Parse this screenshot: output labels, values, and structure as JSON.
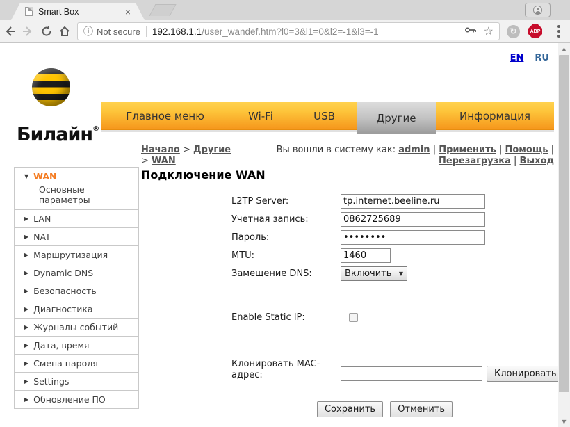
{
  "browser": {
    "tab_title": "Smart Box",
    "security_label": "Not secure",
    "url_domain": "192.168.1.1",
    "url_path": "/user_wandef.htm?l0=3&l1=0&l2=-1&l3=-1",
    "abp_badge": "ABP"
  },
  "icons": {
    "close": "×",
    "star": "☆",
    "info": "ⓘ",
    "sync": "↻",
    "wan_arrow": "▼",
    "item_arrow": "▶",
    "select_arrow": "▼",
    "scroll_up": "▲",
    "scroll_down": "▼"
  },
  "page": {
    "lang": {
      "en": "EN",
      "ru": "RU"
    },
    "logo": {
      "text": "Билайн",
      "reg": "®"
    },
    "nav": [
      {
        "label": "Главное меню"
      },
      {
        "label": "Wi-Fi"
      },
      {
        "label": "USB"
      },
      {
        "label": "Другие"
      },
      {
        "label": "Информация"
      }
    ],
    "breadcrumb": {
      "home": "Начало",
      "sep": ">",
      "section": "Другие",
      "page": "WAN"
    },
    "session": {
      "prefix": "Вы вошли в систему как:",
      "user": "admin",
      "sep": "|",
      "apply": "Применить",
      "help": "Помощь",
      "reboot": "Перезагрузка",
      "logout": "Выход"
    },
    "title": "Подключение WAN",
    "sidebar": {
      "wan_label": "WAN",
      "wan_sub": "Основные параметры",
      "items": [
        {
          "label": "LAN"
        },
        {
          "label": "NAT"
        },
        {
          "label": "Маршрутизация"
        },
        {
          "label": "Dynamic DNS"
        },
        {
          "label": "Безопасность"
        },
        {
          "label": "Диагностика"
        },
        {
          "label": "Журналы событий"
        },
        {
          "label": "Дата, время"
        },
        {
          "label": "Смена пароля"
        },
        {
          "label": "Settings"
        },
        {
          "label": "Обновление ПО"
        }
      ]
    },
    "form": {
      "l2tp_label": "L2TP Server:",
      "l2tp_value": "tp.internet.beeline.ru",
      "account_label": "Учетная запись:",
      "account_value": "0862725689",
      "password_label": "Пароль:",
      "password_value": "••••••••",
      "mtu_label": "MTU:",
      "mtu_value": "1460",
      "dns_label": "Замещение DNS:",
      "dns_value": "Включить",
      "static_ip_label": "Enable Static IP:",
      "mac_label_line1": "Клонировать MAC-",
      "mac_label_line2": "адрес:",
      "mac_value": "",
      "clone_button": "Клонировать",
      "save_button": "Сохранить",
      "cancel_button": "Отменить"
    }
  }
}
